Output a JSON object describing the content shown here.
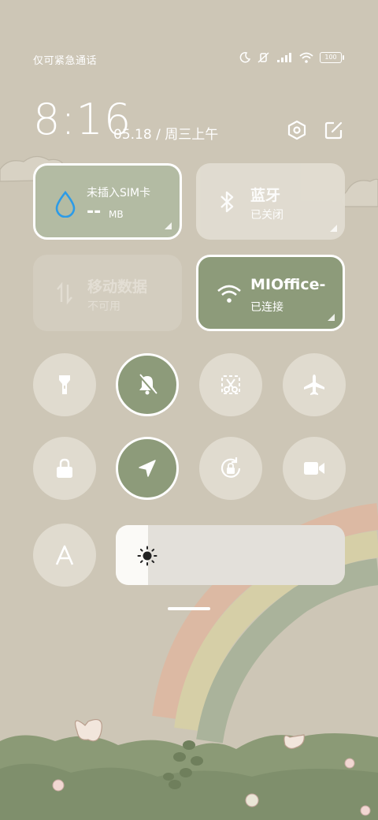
{
  "status_bar": {
    "carrier_text": "仅可紧急通话",
    "battery": "100",
    "icons": [
      "moon-icon",
      "mute-vibrate-icon",
      "signal-icon",
      "wifi-icon",
      "battery-icon"
    ]
  },
  "header": {
    "time": "8:16",
    "date": "05.18 / 周三上午",
    "icons": [
      "settings-icon",
      "edit-icon"
    ]
  },
  "tiles": {
    "sim": {
      "title": "未插入SIM卡",
      "value": "--",
      "unit": "MB",
      "icon": "water-drop-icon"
    },
    "bluetooth": {
      "title": "蓝牙",
      "status": "已关闭",
      "icon": "bluetooth-icon"
    },
    "mobile_data": {
      "title": "移动数据",
      "status": "不可用",
      "icon": "data-arrows-icon"
    },
    "wifi": {
      "title": "MIOffice-",
      "status": "已连接",
      "icon": "wifi-icon"
    }
  },
  "toggles": [
    {
      "name": "flashlight",
      "icon": "flashlight-icon",
      "active": false
    },
    {
      "name": "mute",
      "icon": "bell-off-icon",
      "active": true
    },
    {
      "name": "screenshot",
      "icon": "scissors-icon",
      "active": false
    },
    {
      "name": "airplane",
      "icon": "airplane-icon",
      "active": false
    },
    {
      "name": "lock",
      "icon": "lock-icon",
      "active": false
    },
    {
      "name": "location",
      "icon": "location-arrow-icon",
      "active": true
    },
    {
      "name": "rotation-lock",
      "icon": "rotation-lock-icon",
      "active": false
    },
    {
      "name": "screen-record",
      "icon": "video-camera-icon",
      "active": false
    },
    {
      "name": "auto-text",
      "icon": "letter-a-icon",
      "active": false
    }
  ],
  "brightness": {
    "icon": "sun-icon",
    "level": 0.14
  },
  "colors": {
    "background": "#cdc6b6",
    "accent_green": "#8d9b7a",
    "sim_tile": "#b3bba3",
    "tile_light": "#e2ddd2",
    "drop_blue": "#2b9be8"
  }
}
